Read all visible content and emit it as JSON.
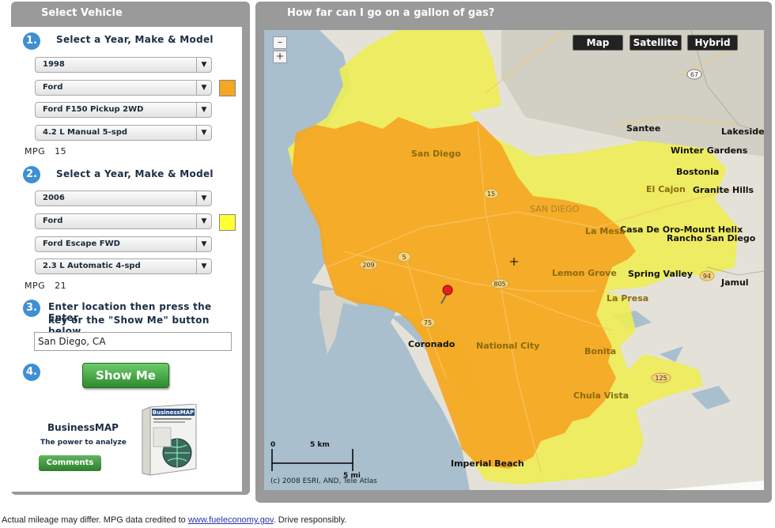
{
  "left_panel": {
    "title": "Select Vehicle",
    "vehicle1": {
      "step": "1.",
      "heading": "Select a Year, Make & Model",
      "year": "1998",
      "make": "Ford",
      "model": "Ford F150 Pickup 2WD",
      "engine": "4.2 L Manual 5-spd",
      "color": "#f5a623",
      "mpg_label": "MPG",
      "mpg_value": "15"
    },
    "vehicle2": {
      "step": "2.",
      "heading": "Select a Year, Make & Model",
      "year": "2006",
      "make": "Ford",
      "model": "Ford Escape FWD",
      "engine": "2.3 L Automatic 4-spd",
      "color": "#ffff33",
      "mpg_label": "MPG",
      "mpg_value": "21"
    },
    "location": {
      "step": "3.",
      "line1": "Enter location then press the Enter",
      "line2": "key or the \"Show Me\" button below",
      "value": "San Diego, CA"
    },
    "action": {
      "step": "4.",
      "button": "Show Me"
    },
    "promo": {
      "title": "BusinessMAP",
      "subtitle": "The power to analyze",
      "comments_button": "Comments",
      "box_text": "BusinessMAP"
    }
  },
  "right_panel": {
    "title": "How far can I go on a gallon of gas?",
    "map_types": [
      "Map",
      "Satellite",
      "Hybrid"
    ],
    "zoom_out": "–",
    "zoom_in": "+",
    "scale_zero": "0",
    "scale_km": "5 km",
    "scale_mi": "5 mi",
    "copyright": "(c) 2008 ESRI, AND, Tele Atlas",
    "labels": {
      "santee": "Santee",
      "lakeside": "Lakeside",
      "winter_gardens": "Winter Gardens",
      "bostonia": "Bostonia",
      "el_cajon": "El Cajon",
      "granite_hills": "Granite Hills",
      "san_diego": "San Diego",
      "san_diego_caps": "SAN DIEGO",
      "la_mesa": "La Mesa",
      "casa_de_oro": "Casa De Oro-Mount Helix",
      "rancho_san_diego": "Rancho San Diego",
      "lemon_grove": "Lemon Grove",
      "spring_valley": "Spring Valley",
      "jamul": "Jamul",
      "la_presa": "La Presa",
      "coronado": "Coronado",
      "national_city": "National City",
      "bonita": "Bonita",
      "chula_vista": "Chula Vista",
      "imperial_beach": "Imperial Beach",
      "hwy_67": "67",
      "hwy_15": "15",
      "hwy_5": "5",
      "hwy_209": "209",
      "hwy_805": "805",
      "hwy_75": "75",
      "hwy_94": "94",
      "hwy_125": "125"
    }
  },
  "footer": {
    "prefix": "Actual mileage may differ. MPG data credited to ",
    "link": "www.fueleconomy.gov",
    "suffix": ". Drive responsibly."
  }
}
